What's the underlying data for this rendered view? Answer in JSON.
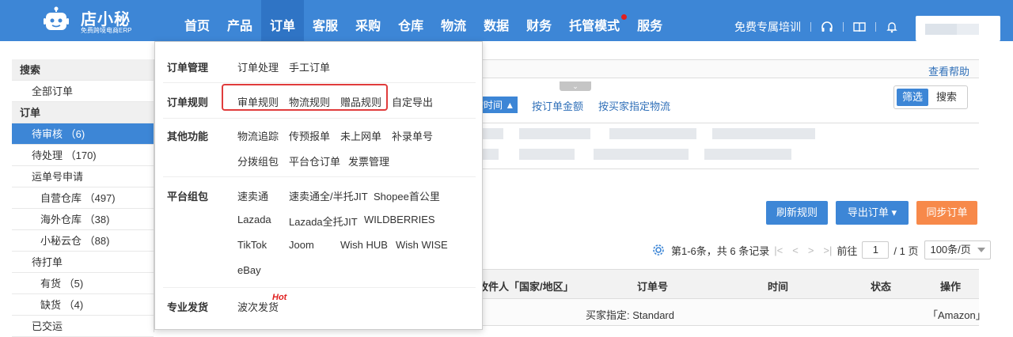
{
  "brand": {
    "name": "店小秘",
    "tagline": "免费跨境电商ERP"
  },
  "nav": {
    "items": [
      "首页",
      "产品",
      "订单",
      "客服",
      "采购",
      "仓库",
      "物流",
      "数据",
      "财务",
      "托管模式",
      "服务"
    ],
    "active": "订单"
  },
  "top_right": {
    "training": "免费专属培训"
  },
  "sidebar": {
    "search_head": "搜索",
    "all_orders": "全部订单",
    "orders_head": "订单",
    "pending_review": "待审核 （6)",
    "pending_process": "待处理 （170)",
    "waybill": "运单号申请",
    "own_wh": "自营仓库 （497)",
    "overseas_wh": "海外仓库 （38)",
    "cloud_wh": "小秘云仓 （88)",
    "pending_print": "待打单",
    "in_stock": "有货 （5)",
    "out_stock": "缺货 （4)",
    "shipped": "已交运"
  },
  "dropdown": {
    "order_mgmt": {
      "label": "订单管理",
      "items": [
        "订单处理",
        "手工订单"
      ]
    },
    "order_rules": {
      "label": "订单规则",
      "items": [
        "审单规则",
        "物流规则",
        "赠品规则",
        "自定导出"
      ]
    },
    "other": {
      "label": "其他功能",
      "row1": [
        "物流追踪",
        "传预报单",
        "未上网单",
        "补录单号"
      ],
      "row2": [
        "分拨组包",
        "平台仓订单",
        "发票管理"
      ]
    },
    "platform": {
      "label": "平台组包",
      "row1": [
        "速卖通",
        "速卖通全/半托JIT",
        "Shopee首公里"
      ],
      "row2": [
        "Lazada",
        "Lazada全托JIT",
        "WILDBERRIES"
      ],
      "row3": [
        "TikTok",
        "Joom",
        "Wish HUB",
        "Wish WISE"
      ],
      "row4": [
        "eBay"
      ]
    },
    "pro": {
      "label": "专业发货",
      "item": "波次发货",
      "hot": "Hot"
    }
  },
  "main": {
    "help": "查看帮助",
    "sort_active": "按时间 ▲",
    "sort_amount": "按订单金额",
    "sort_logistics": "按买家指定物流",
    "filter_on": "筛选",
    "filter_off": "搜索",
    "btn_refresh": "刷新规则",
    "btn_export": "导出订单",
    "btn_sync": "同步订单",
    "pager_info": "第1-6条，共 6 条记录",
    "pager_goto": "前往",
    "pager_page": "1",
    "pager_total": "/ 1 页",
    "pager_size": "100条/页",
    "col_recipient": "收件人「国家/地区」",
    "col_order": "订单号",
    "col_time": "时间",
    "col_status": "状态",
    "col_action": "操作",
    "row_buyer": "买家指定:  Standard",
    "row_platform": "「Amazon」"
  },
  "colors": {
    "primary": "#3d86d6",
    "accent_orange": "#f7894a",
    "highlight_red": "#e03c3c"
  }
}
